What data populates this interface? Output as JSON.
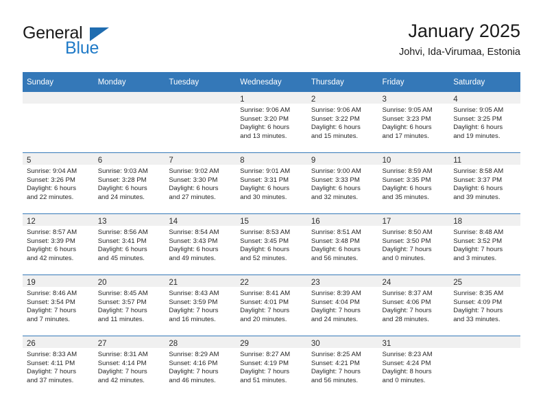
{
  "brand": {
    "name_part1": "General",
    "name_part2": "Blue",
    "triangle_color": "#1f6cb0",
    "blue_color": "#1f7ac7"
  },
  "header": {
    "title": "January 2025",
    "location": "Johvi, Ida-Virumaa, Estonia"
  },
  "theme": {
    "header_bg": "#3478b8",
    "day_band_bg": "#f0f0f0",
    "row_border": "#3478b8"
  },
  "columns": [
    "Sunday",
    "Monday",
    "Tuesday",
    "Wednesday",
    "Thursday",
    "Friday",
    "Saturday"
  ],
  "weeks": [
    [
      {
        "day": "",
        "lines": []
      },
      {
        "day": "",
        "lines": []
      },
      {
        "day": "",
        "lines": []
      },
      {
        "day": "1",
        "lines": [
          "Sunrise: 9:06 AM",
          "Sunset: 3:20 PM",
          "Daylight: 6 hours",
          "and 13 minutes."
        ]
      },
      {
        "day": "2",
        "lines": [
          "Sunrise: 9:06 AM",
          "Sunset: 3:22 PM",
          "Daylight: 6 hours",
          "and 15 minutes."
        ]
      },
      {
        "day": "3",
        "lines": [
          "Sunrise: 9:05 AM",
          "Sunset: 3:23 PM",
          "Daylight: 6 hours",
          "and 17 minutes."
        ]
      },
      {
        "day": "4",
        "lines": [
          "Sunrise: 9:05 AM",
          "Sunset: 3:25 PM",
          "Daylight: 6 hours",
          "and 19 minutes."
        ]
      }
    ],
    [
      {
        "day": "5",
        "lines": [
          "Sunrise: 9:04 AM",
          "Sunset: 3:26 PM",
          "Daylight: 6 hours",
          "and 22 minutes."
        ]
      },
      {
        "day": "6",
        "lines": [
          "Sunrise: 9:03 AM",
          "Sunset: 3:28 PM",
          "Daylight: 6 hours",
          "and 24 minutes."
        ]
      },
      {
        "day": "7",
        "lines": [
          "Sunrise: 9:02 AM",
          "Sunset: 3:30 PM",
          "Daylight: 6 hours",
          "and 27 minutes."
        ]
      },
      {
        "day": "8",
        "lines": [
          "Sunrise: 9:01 AM",
          "Sunset: 3:31 PM",
          "Daylight: 6 hours",
          "and 30 minutes."
        ]
      },
      {
        "day": "9",
        "lines": [
          "Sunrise: 9:00 AM",
          "Sunset: 3:33 PM",
          "Daylight: 6 hours",
          "and 32 minutes."
        ]
      },
      {
        "day": "10",
        "lines": [
          "Sunrise: 8:59 AM",
          "Sunset: 3:35 PM",
          "Daylight: 6 hours",
          "and 35 minutes."
        ]
      },
      {
        "day": "11",
        "lines": [
          "Sunrise: 8:58 AM",
          "Sunset: 3:37 PM",
          "Daylight: 6 hours",
          "and 39 minutes."
        ]
      }
    ],
    [
      {
        "day": "12",
        "lines": [
          "Sunrise: 8:57 AM",
          "Sunset: 3:39 PM",
          "Daylight: 6 hours",
          "and 42 minutes."
        ]
      },
      {
        "day": "13",
        "lines": [
          "Sunrise: 8:56 AM",
          "Sunset: 3:41 PM",
          "Daylight: 6 hours",
          "and 45 minutes."
        ]
      },
      {
        "day": "14",
        "lines": [
          "Sunrise: 8:54 AM",
          "Sunset: 3:43 PM",
          "Daylight: 6 hours",
          "and 49 minutes."
        ]
      },
      {
        "day": "15",
        "lines": [
          "Sunrise: 8:53 AM",
          "Sunset: 3:45 PM",
          "Daylight: 6 hours",
          "and 52 minutes."
        ]
      },
      {
        "day": "16",
        "lines": [
          "Sunrise: 8:51 AM",
          "Sunset: 3:48 PM",
          "Daylight: 6 hours",
          "and 56 minutes."
        ]
      },
      {
        "day": "17",
        "lines": [
          "Sunrise: 8:50 AM",
          "Sunset: 3:50 PM",
          "Daylight: 7 hours",
          "and 0 minutes."
        ]
      },
      {
        "day": "18",
        "lines": [
          "Sunrise: 8:48 AM",
          "Sunset: 3:52 PM",
          "Daylight: 7 hours",
          "and 3 minutes."
        ]
      }
    ],
    [
      {
        "day": "19",
        "lines": [
          "Sunrise: 8:46 AM",
          "Sunset: 3:54 PM",
          "Daylight: 7 hours",
          "and 7 minutes."
        ]
      },
      {
        "day": "20",
        "lines": [
          "Sunrise: 8:45 AM",
          "Sunset: 3:57 PM",
          "Daylight: 7 hours",
          "and 11 minutes."
        ]
      },
      {
        "day": "21",
        "lines": [
          "Sunrise: 8:43 AM",
          "Sunset: 3:59 PM",
          "Daylight: 7 hours",
          "and 16 minutes."
        ]
      },
      {
        "day": "22",
        "lines": [
          "Sunrise: 8:41 AM",
          "Sunset: 4:01 PM",
          "Daylight: 7 hours",
          "and 20 minutes."
        ]
      },
      {
        "day": "23",
        "lines": [
          "Sunrise: 8:39 AM",
          "Sunset: 4:04 PM",
          "Daylight: 7 hours",
          "and 24 minutes."
        ]
      },
      {
        "day": "24",
        "lines": [
          "Sunrise: 8:37 AM",
          "Sunset: 4:06 PM",
          "Daylight: 7 hours",
          "and 28 minutes."
        ]
      },
      {
        "day": "25",
        "lines": [
          "Sunrise: 8:35 AM",
          "Sunset: 4:09 PM",
          "Daylight: 7 hours",
          "and 33 minutes."
        ]
      }
    ],
    [
      {
        "day": "26",
        "lines": [
          "Sunrise: 8:33 AM",
          "Sunset: 4:11 PM",
          "Daylight: 7 hours",
          "and 37 minutes."
        ]
      },
      {
        "day": "27",
        "lines": [
          "Sunrise: 8:31 AM",
          "Sunset: 4:14 PM",
          "Daylight: 7 hours",
          "and 42 minutes."
        ]
      },
      {
        "day": "28",
        "lines": [
          "Sunrise: 8:29 AM",
          "Sunset: 4:16 PM",
          "Daylight: 7 hours",
          "and 46 minutes."
        ]
      },
      {
        "day": "29",
        "lines": [
          "Sunrise: 8:27 AM",
          "Sunset: 4:19 PM",
          "Daylight: 7 hours",
          "and 51 minutes."
        ]
      },
      {
        "day": "30",
        "lines": [
          "Sunrise: 8:25 AM",
          "Sunset: 4:21 PM",
          "Daylight: 7 hours",
          "and 56 minutes."
        ]
      },
      {
        "day": "31",
        "lines": [
          "Sunrise: 8:23 AM",
          "Sunset: 4:24 PM",
          "Daylight: 8 hours",
          "and 0 minutes."
        ]
      },
      {
        "day": "",
        "lines": []
      }
    ]
  ]
}
